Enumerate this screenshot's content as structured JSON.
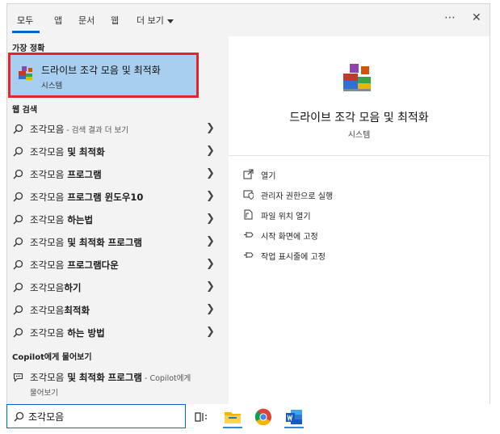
{
  "tabs": [
    {
      "label": "모두",
      "active": true
    },
    {
      "label": "앱"
    },
    {
      "label": "문서"
    },
    {
      "label": "웹"
    },
    {
      "label": "더 보기"
    }
  ],
  "top_icons": {
    "more": "⋯",
    "close": "✕"
  },
  "best_match": {
    "section_label": "가장 정확",
    "title": "드라이브 조각 모음 및 최적화",
    "subtitle": "시스템"
  },
  "web_search": {
    "section_label": "웹 검색",
    "items": [
      {
        "prefix": "조각모음",
        "bold": "",
        "hint": " - 검색 결과 더 보기"
      },
      {
        "prefix": "조각모음",
        "bold": " 및 최적화",
        "hint": ""
      },
      {
        "prefix": "조각모음",
        "bold": " 프로그램",
        "hint": ""
      },
      {
        "prefix": "조각모음",
        "bold": " 프로그램 윈도우10",
        "hint": ""
      },
      {
        "prefix": "조각모음",
        "bold": " 하는법",
        "hint": ""
      },
      {
        "prefix": "조각모음",
        "bold": " 및 최적화 프로그램",
        "hint": ""
      },
      {
        "prefix": "조각모음",
        "bold": " 프로그램다운",
        "hint": ""
      },
      {
        "prefix": "조각모음",
        "bold": "하기",
        "hint": ""
      },
      {
        "prefix": "조각모음",
        "bold": "최적화",
        "hint": ""
      },
      {
        "prefix": "조각모음",
        "bold": " 하는 방법",
        "hint": ""
      }
    ]
  },
  "copilot": {
    "section_label": "Copilot에게 물어보기",
    "prefix": "조각모음",
    "bold": " 및 최적화 프로그램",
    "hint_line1": " - Copilot에게",
    "hint_line2": "물어보기"
  },
  "preview": {
    "title": "드라이브 조각 모음 및 최적화",
    "subtitle": "시스템",
    "actions": [
      {
        "label": "열기",
        "icon": "open-icon"
      },
      {
        "label": "관리자 권한으로 실행",
        "icon": "admin-shield-icon"
      },
      {
        "label": "파일 위치 열기",
        "icon": "file-location-icon"
      },
      {
        "label": "시작 화면에 고정",
        "icon": "pin-icon"
      },
      {
        "label": "작업 표시줄에 고정",
        "icon": "pin-icon"
      }
    ]
  },
  "search_box": {
    "value": "조각모음"
  },
  "taskbar_icons": [
    "task-view-icon",
    "file-explorer-icon",
    "chrome-icon",
    "word-icon"
  ],
  "colors": {
    "accent": "#0a64c8",
    "best_bg": "#a9cff0",
    "highlight_border": "#e0252b"
  }
}
